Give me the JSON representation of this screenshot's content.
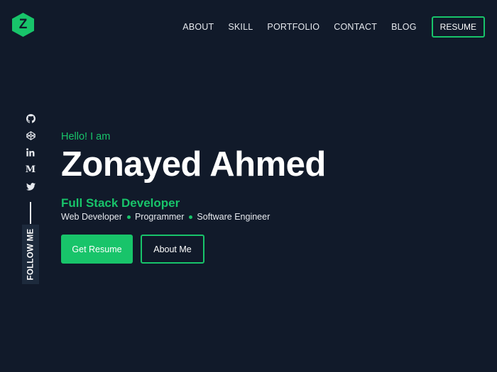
{
  "brand": {
    "logo_letter": "Z",
    "accent": "#18c46a",
    "background": "#111a2a"
  },
  "nav": {
    "items": [
      "ABOUT",
      "SKILL",
      "PORTFOLIO",
      "CONTACT",
      "BLOG"
    ],
    "resume_label": "RESUME"
  },
  "social": {
    "icons": [
      "github-icon",
      "codepen-icon",
      "linkedin-icon",
      "medium-icon",
      "twitter-icon"
    ],
    "follow_label": "FOLLOW ME"
  },
  "hero": {
    "greeting": "Hello! I am",
    "name": "Zonayed Ahmed",
    "role": "Full Stack Developer",
    "skills": [
      "Web Developer",
      "Programmer",
      "Software Engineer"
    ],
    "primary_button": "Get Resume",
    "secondary_button": "About Me"
  }
}
